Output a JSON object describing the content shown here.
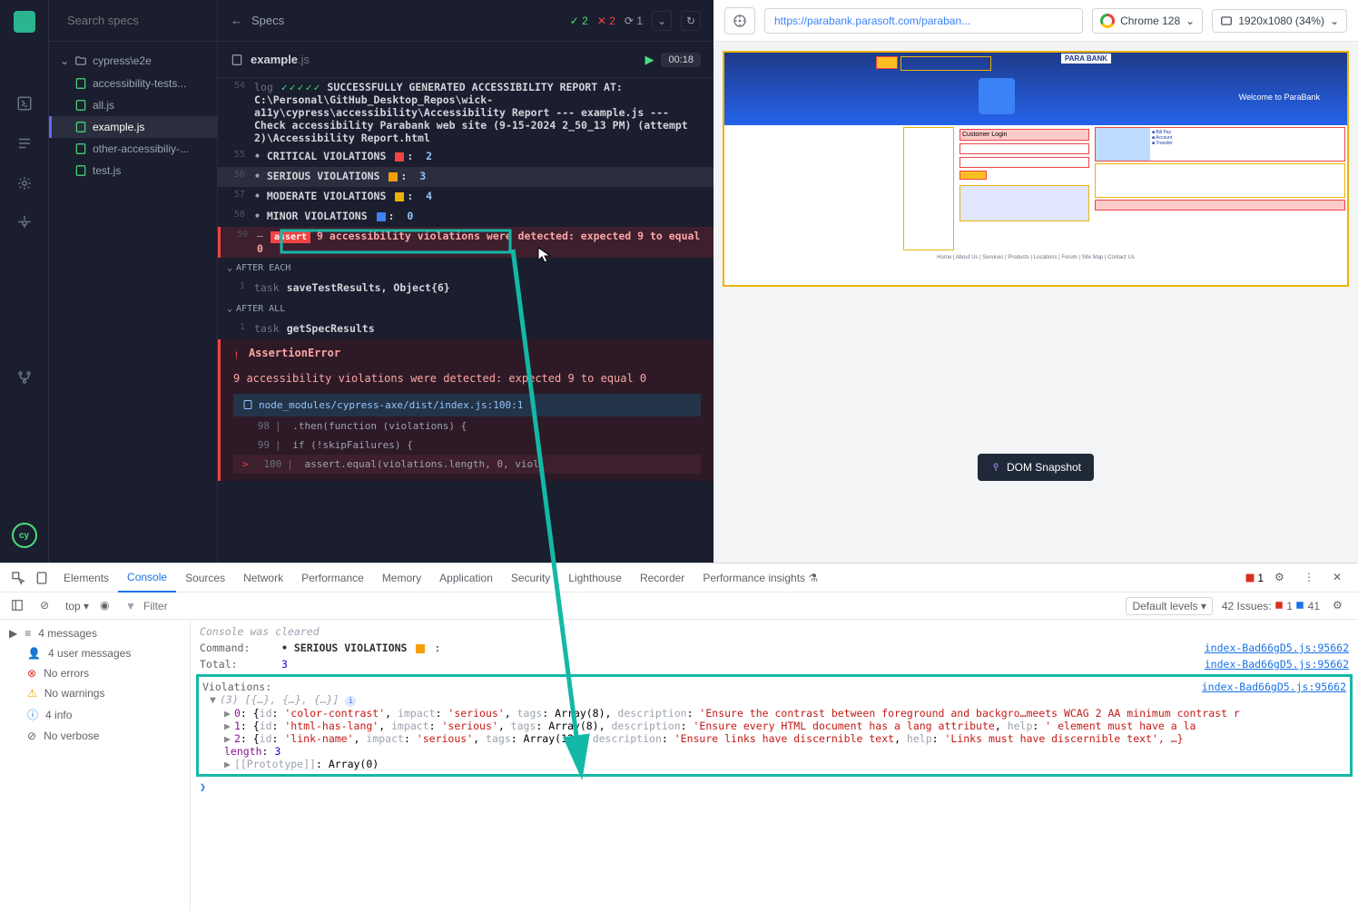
{
  "sidebar": {
    "search_placeholder": "Search specs",
    "folder": "cypress\\e2e",
    "files": [
      {
        "name": "accessibility-tests...",
        "active": false
      },
      {
        "name": "all.js",
        "active": false
      },
      {
        "name": "example.js",
        "active": true
      },
      {
        "name": "other-accessibiliy-...",
        "active": false
      },
      {
        "name": "test.js",
        "active": false
      }
    ]
  },
  "main_header": {
    "title": "Specs",
    "pass": "2",
    "fail": "2",
    "pending": "1"
  },
  "file_tab": {
    "name": "example",
    "ext": ".js",
    "time": "00:18"
  },
  "log": {
    "line54": "SUCCESSFULLY GENERATED ACCESSIBILITY REPORT AT: C:\\Personal\\GitHub_Desktop_Repos\\wick-a11y\\cypress\\accessibility\\Accessibility Report --- example.js --- Check accessibility Parabank web site (9-15-2024 2_50_13 PM) (attempt 2)\\Accessibility Report.html",
    "violations": [
      {
        "num": "55",
        "label": "CRITICAL VIOLATIONS",
        "cls": "viol-critical",
        "count": "2"
      },
      {
        "num": "56",
        "label": "SERIOUS VIOLATIONS",
        "cls": "viol-serious",
        "count": "3"
      },
      {
        "num": "57",
        "label": "MODERATE VIOLATIONS",
        "cls": "viol-moderate",
        "count": "4"
      },
      {
        "num": "58",
        "label": "MINOR VIOLATIONS",
        "cls": "viol-minor",
        "count": "0"
      }
    ],
    "assert_line_num": "59",
    "assert_text": "9 accessibility violations were detected: expected 9 to equal 0",
    "after_each": "AFTER EACH",
    "after_each_num": "1",
    "after_each_cmd": "task",
    "after_each_args": "saveTestResults, Object{6}",
    "after_all": "AFTER ALL",
    "after_all_num": "1",
    "after_all_cmd": "task",
    "after_all_args": "getSpecResults",
    "error_num": "!",
    "error_title": "AssertionError",
    "error_msg": "9 accessibility violations were detected: expected 9 to equal 0",
    "error_file": "node_modules/cypress-axe/dist/index.js:100:1",
    "code": [
      {
        "n": "98",
        "err": false,
        "txt": "      .then(function (violations) {",
        "pre": ""
      },
      {
        "n": "99",
        "err": false,
        "txt": "      if (!skipFailures) {",
        "pre": ""
      },
      {
        "n": "100",
        "err": true,
        "txt": "          assert.equal(violations.length, 0, viol",
        "pre": "> "
      }
    ]
  },
  "preview": {
    "url": "https://parabank.parasoft.com/paraban...",
    "browser": "Chrome 128",
    "resolution": "1920x1080 (34%)",
    "dom_snapshot": "DOM Snapshot",
    "site_brand": "PARA BANK",
    "site_welcome": "Welcome to ParaBank",
    "customer_login": "Customer Login"
  },
  "devtools": {
    "tabs": [
      "Elements",
      "Console",
      "Sources",
      "Network",
      "Performance",
      "Memory",
      "Application",
      "Security",
      "Lighthouse",
      "Recorder",
      "Performance insights"
    ],
    "active_tab": "Console",
    "header_badge": "1",
    "context": "top",
    "filter_placeholder": "Filter",
    "levels": "Default levels",
    "issues_label": "42 Issues:",
    "issues_err": "1",
    "issues_msg": "41",
    "sidebar_items": [
      {
        "icon": "list",
        "label": "4 messages"
      },
      {
        "icon": "user",
        "label": "4 user messages"
      },
      {
        "icon": "err",
        "label": "No errors"
      },
      {
        "icon": "warn",
        "label": "No warnings"
      },
      {
        "icon": "info",
        "label": "4 info"
      },
      {
        "icon": "verbose",
        "label": "No verbose"
      }
    ],
    "console": {
      "cleared": "Console was cleared",
      "command_label": "Command:",
      "command_val": "• SERIOUS VIOLATIONS",
      "total_label": "Total:",
      "total_val": "3",
      "violations_label": "Violations:",
      "src_link": "index-Bad66gD5.js:95662",
      "array_summary": "(3) [{…}, {…}, {…}]",
      "items": [
        {
          "idx": "0",
          "id": "color-contrast",
          "impact": "serious",
          "tags": "Array(8)",
          "desc": "Ensure the contrast between foreground and backgro…meets WCAG 2 AA minimum contrast r"
        },
        {
          "idx": "1",
          "id": "html-has-lang",
          "impact": "serious",
          "tags": "Array(8)",
          "desc": "Ensure every HTML document has a lang attribute",
          "help": "'<html> element must have a la"
        },
        {
          "idx": "2",
          "id": "link-name",
          "impact": "serious",
          "tags": "Array(12)",
          "desc": "Ensure links have discernible text",
          "help": "'Links must have discernible text', …}"
        }
      ],
      "length_label": "length",
      "length_val": "3",
      "proto": "[[Prototype]]",
      "proto_val": "Array(0)"
    }
  }
}
